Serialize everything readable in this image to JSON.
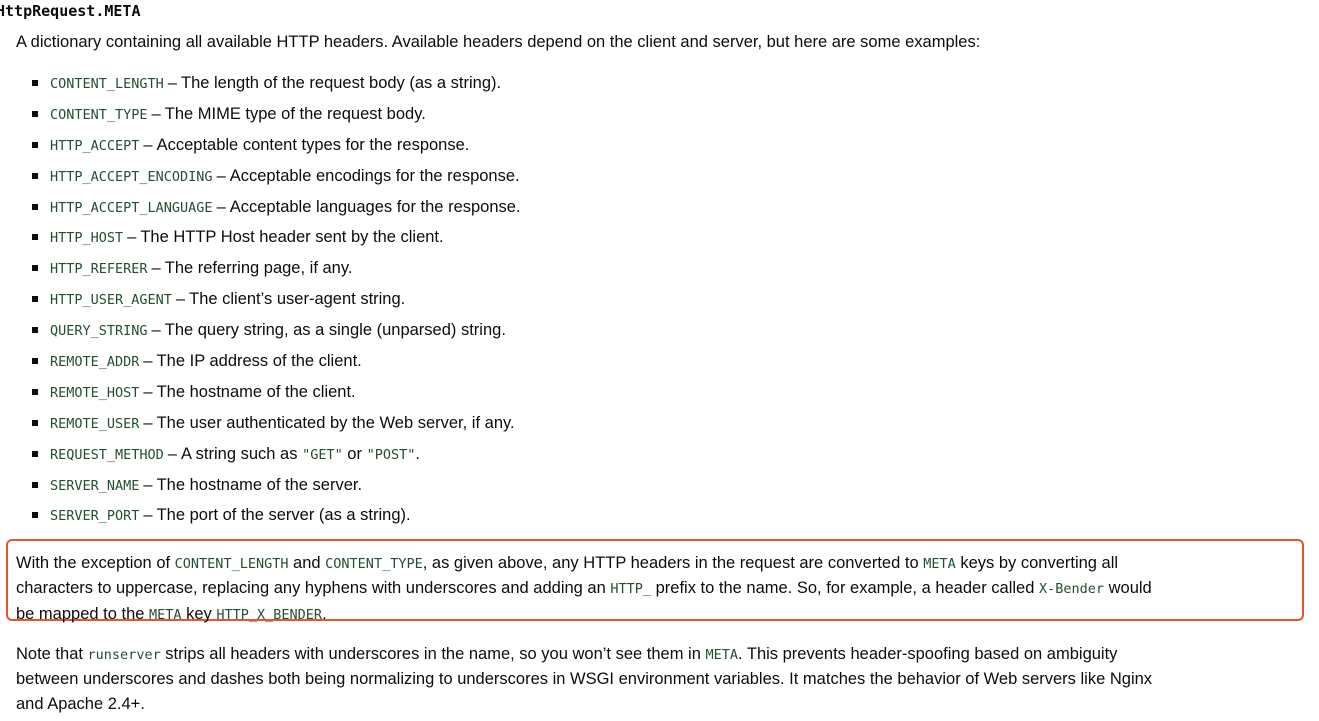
{
  "title": "HttpRequest.META",
  "intro": "A dictionary containing all available HTTP headers. Available headers depend on the client and server, but here are some examples:",
  "dash": "–",
  "items": [
    {
      "code": "CONTENT_LENGTH",
      "desc": "The length of the request body (as a string)."
    },
    {
      "code": "CONTENT_TYPE",
      "desc": "The MIME type of the request body."
    },
    {
      "code": "HTTP_ACCEPT",
      "desc": "Acceptable content types for the response."
    },
    {
      "code": "HTTP_ACCEPT_ENCODING",
      "desc": "Acceptable encodings for the response."
    },
    {
      "code": "HTTP_ACCEPT_LANGUAGE",
      "desc": "Acceptable languages for the response."
    },
    {
      "code": "HTTP_HOST",
      "desc": "The HTTP Host header sent by the client."
    },
    {
      "code": "HTTP_REFERER",
      "desc": "The referring page, if any."
    },
    {
      "code": "HTTP_USER_AGENT",
      "desc": "The client’s user-agent string."
    },
    {
      "code": "QUERY_STRING",
      "desc": "The query string, as a single (unparsed) string."
    },
    {
      "code": "REMOTE_ADDR",
      "desc": "The IP address of the client."
    },
    {
      "code": "REMOTE_HOST",
      "desc": "The hostname of the client."
    },
    {
      "code": "REMOTE_USER",
      "desc": "The user authenticated by the Web server, if any."
    },
    {
      "code": "REQUEST_METHOD",
      "desc": "A string such as",
      "code2": "\"GET\"",
      "desc_mid": "or",
      "code3": "\"POST\"",
      "desc_end": "."
    },
    {
      "code": "SERVER_NAME",
      "desc": "The hostname of the server."
    },
    {
      "code": "SERVER_PORT",
      "desc": "The port of the server (as a string)."
    }
  ],
  "highlight": {
    "line1": {
      "t1": "With the exception of ",
      "c1": "CONTENT_LENGTH",
      "t2": " and ",
      "c2": "CONTENT_TYPE",
      "t3": ", as given above, any HTTP headers in the request are converted to ",
      "c3": "META",
      "t4": " keys by converting all"
    },
    "line2": {
      "t1": "characters to uppercase, replacing any hyphens with underscores and adding an ",
      "c1": "HTTP_",
      "t2": " prefix to the name. So, for example, a header called ",
      "c2": "X-Bender",
      "t3": " would"
    },
    "line3": {
      "t1": "be mapped to the ",
      "c1": "META",
      "t2": " key ",
      "c2": "HTTP_X_BENDER",
      "t3": "."
    },
    "border_color": "#e8542c"
  },
  "note": {
    "line1": {
      "t1": "Note that ",
      "c1": "runserver",
      "t2": " strips all headers with underscores in the name, so you won’t see them in ",
      "c2": "META",
      "t3": ". This prevents header-spoofing based on ambiguity"
    },
    "line2": "between underscores and dashes both being normalizing to underscores in WSGI environment variables. It matches the behavior of Web servers like Nginx",
    "line3": "and Apache 2.4+."
  },
  "colors": {
    "code": "#234f32",
    "text": "#0c0c0c"
  }
}
